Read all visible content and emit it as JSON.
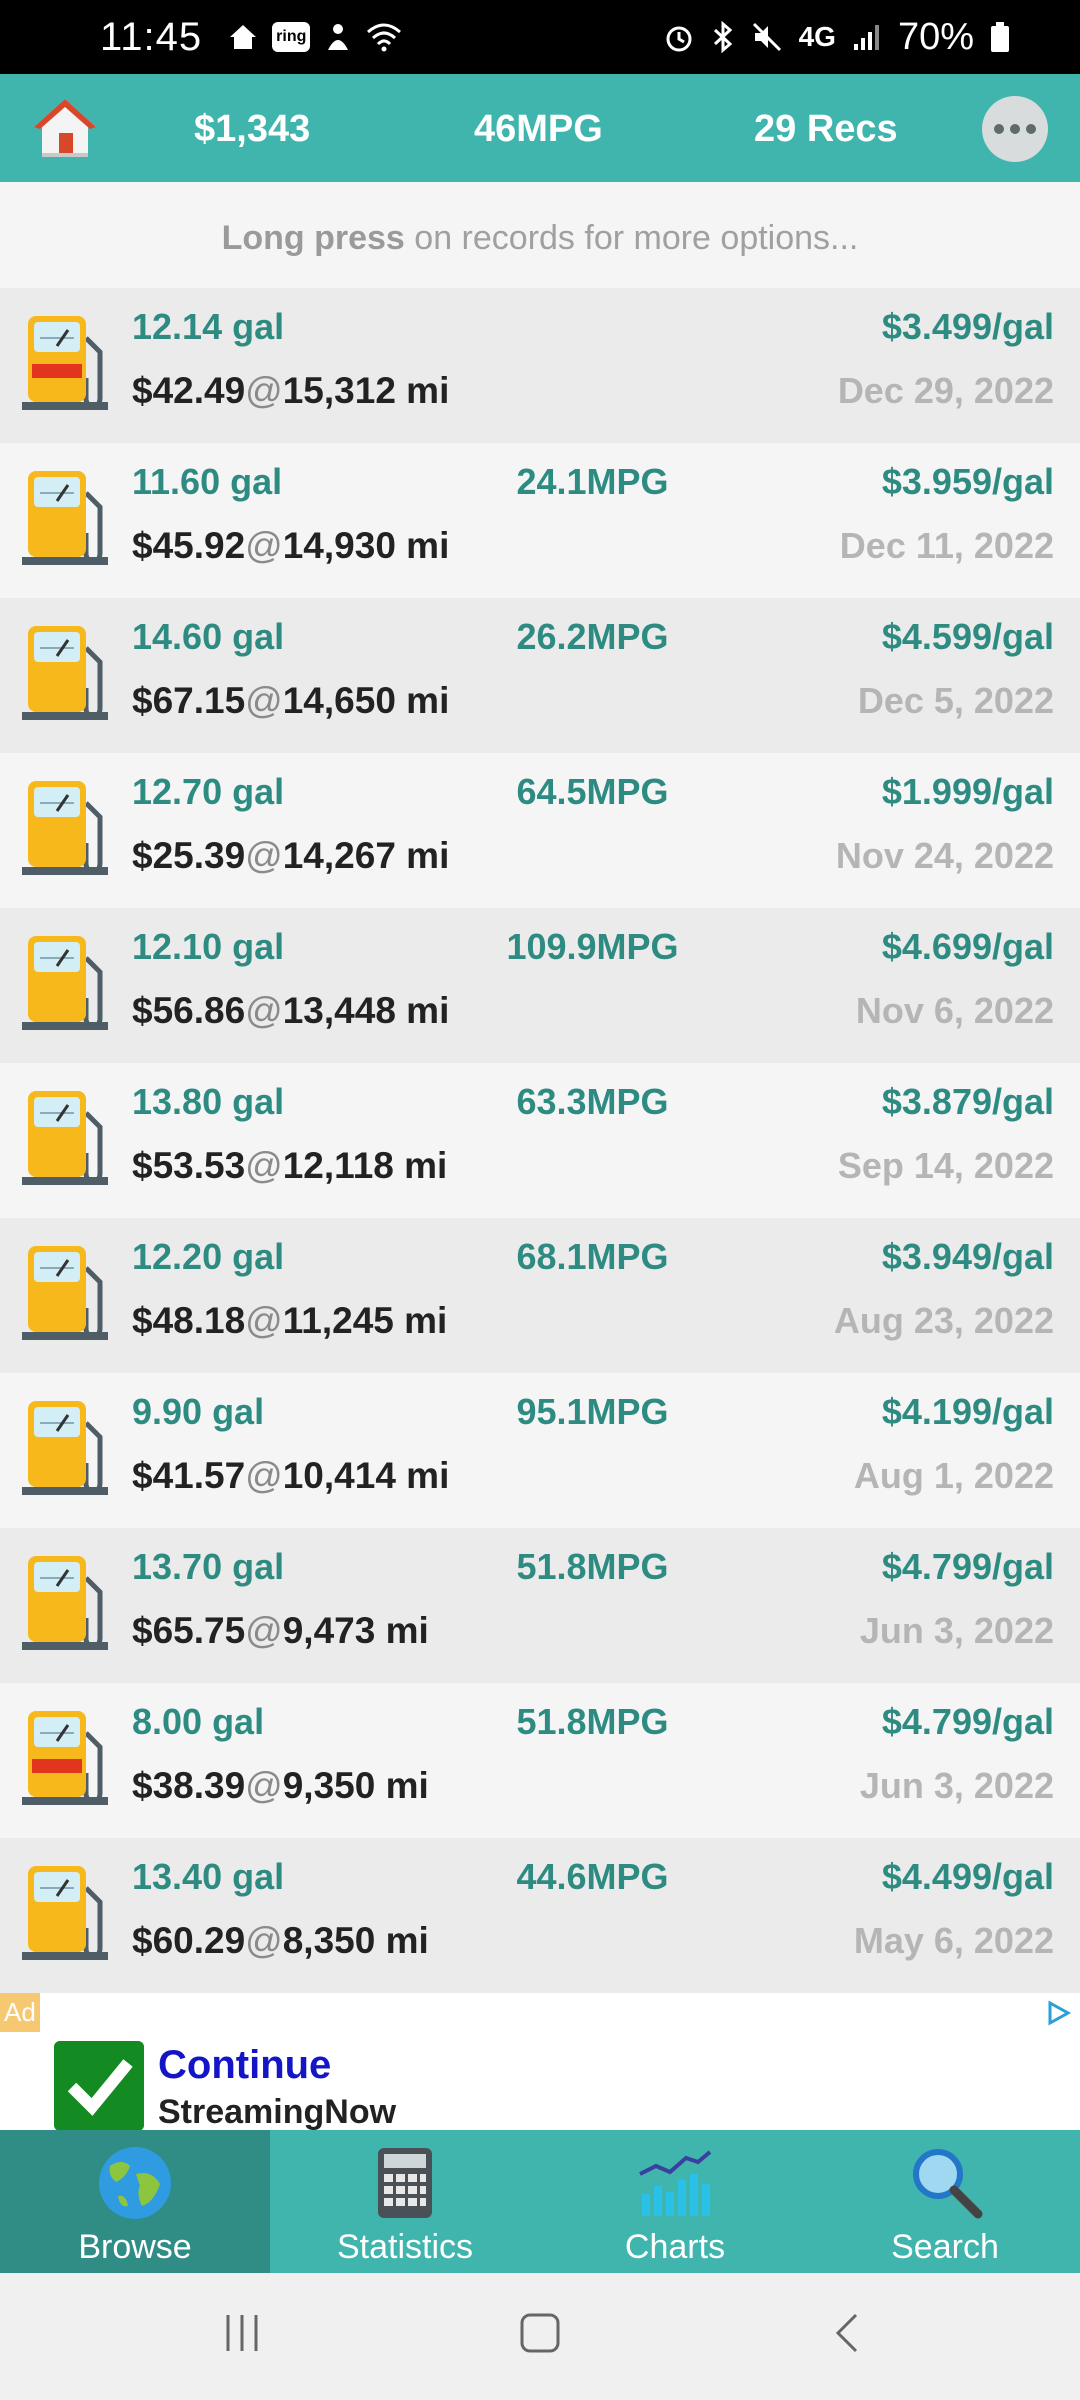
{
  "status_bar": {
    "time": "11:45",
    "ring_label": "ring",
    "network": "4G",
    "battery": "70%"
  },
  "app_bar": {
    "total_cost": "$1,343",
    "avg_mpg": "46MPG",
    "record_count": "29 Recs"
  },
  "hint": {
    "bold": "Long press",
    "rest": " on records for more options..."
  },
  "records": [
    {
      "gallons": "12.14 gal",
      "mpg": "",
      "price_per_gal": "$3.499/gal",
      "cost": "$42.49",
      "at": "@",
      "odometer": "15,312 mi",
      "date": "Dec 29, 2022",
      "partial": true
    },
    {
      "gallons": "11.60 gal",
      "mpg": "24.1MPG",
      "price_per_gal": "$3.959/gal",
      "cost": "$45.92",
      "at": "@",
      "odometer": "14,930 mi",
      "date": "Dec 11, 2022",
      "partial": false
    },
    {
      "gallons": "14.60 gal",
      "mpg": "26.2MPG",
      "price_per_gal": "$4.599/gal",
      "cost": "$67.15",
      "at": "@",
      "odometer": "14,650 mi",
      "date": "Dec 5, 2022",
      "partial": false
    },
    {
      "gallons": "12.70 gal",
      "mpg": "64.5MPG",
      "price_per_gal": "$1.999/gal",
      "cost": "$25.39",
      "at": "@",
      "odometer": "14,267 mi",
      "date": "Nov 24, 2022",
      "partial": false
    },
    {
      "gallons": "12.10 gal",
      "mpg": "109.9MPG",
      "price_per_gal": "$4.699/gal",
      "cost": "$56.86",
      "at": "@",
      "odometer": "13,448 mi",
      "date": "Nov 6, 2022",
      "partial": false
    },
    {
      "gallons": "13.80 gal",
      "mpg": "63.3MPG",
      "price_per_gal": "$3.879/gal",
      "cost": "$53.53",
      "at": "@",
      "odometer": "12,118 mi",
      "date": "Sep 14, 2022",
      "partial": false
    },
    {
      "gallons": "12.20 gal",
      "mpg": "68.1MPG",
      "price_per_gal": "$3.949/gal",
      "cost": "$48.18",
      "at": "@",
      "odometer": "11,245 mi",
      "date": "Aug 23, 2022",
      "partial": false
    },
    {
      "gallons": "9.90 gal",
      "mpg": "95.1MPG",
      "price_per_gal": "$4.199/gal",
      "cost": "$41.57",
      "at": "@",
      "odometer": "10,414 mi",
      "date": "Aug 1, 2022",
      "partial": false
    },
    {
      "gallons": "13.70 gal",
      "mpg": "51.8MPG",
      "price_per_gal": "$4.799/gal",
      "cost": "$65.75",
      "at": "@",
      "odometer": "9,473 mi",
      "date": "Jun 3, 2022",
      "partial": false
    },
    {
      "gallons": "8.00 gal",
      "mpg": "51.8MPG",
      "price_per_gal": "$4.799/gal",
      "cost": "$38.39",
      "at": "@",
      "odometer": "9,350 mi",
      "date": "Jun 3, 2022",
      "partial": true
    },
    {
      "gallons": "13.40 gal",
      "mpg": "44.6MPG",
      "price_per_gal": "$4.499/gal",
      "cost": "$60.29",
      "at": "@",
      "odometer": "8,350 mi",
      "date": "May 6, 2022",
      "partial": false
    }
  ],
  "ad": {
    "tag": "Ad",
    "title": "Continue",
    "subtitle": "StreamingNow"
  },
  "bottom_nav": [
    {
      "label": "Browse",
      "icon": "globe-icon",
      "active": true
    },
    {
      "label": "Statistics",
      "icon": "calculator-icon",
      "active": false
    },
    {
      "label": "Charts",
      "icon": "chart-icon",
      "active": false
    },
    {
      "label": "Search",
      "icon": "magnifier-icon",
      "active": false
    }
  ],
  "colors": {
    "accent": "#3fb5ad",
    "accent_dark": "#2f8d86",
    "value_text": "#2e8b82",
    "date_text": "#b5b5b5"
  }
}
